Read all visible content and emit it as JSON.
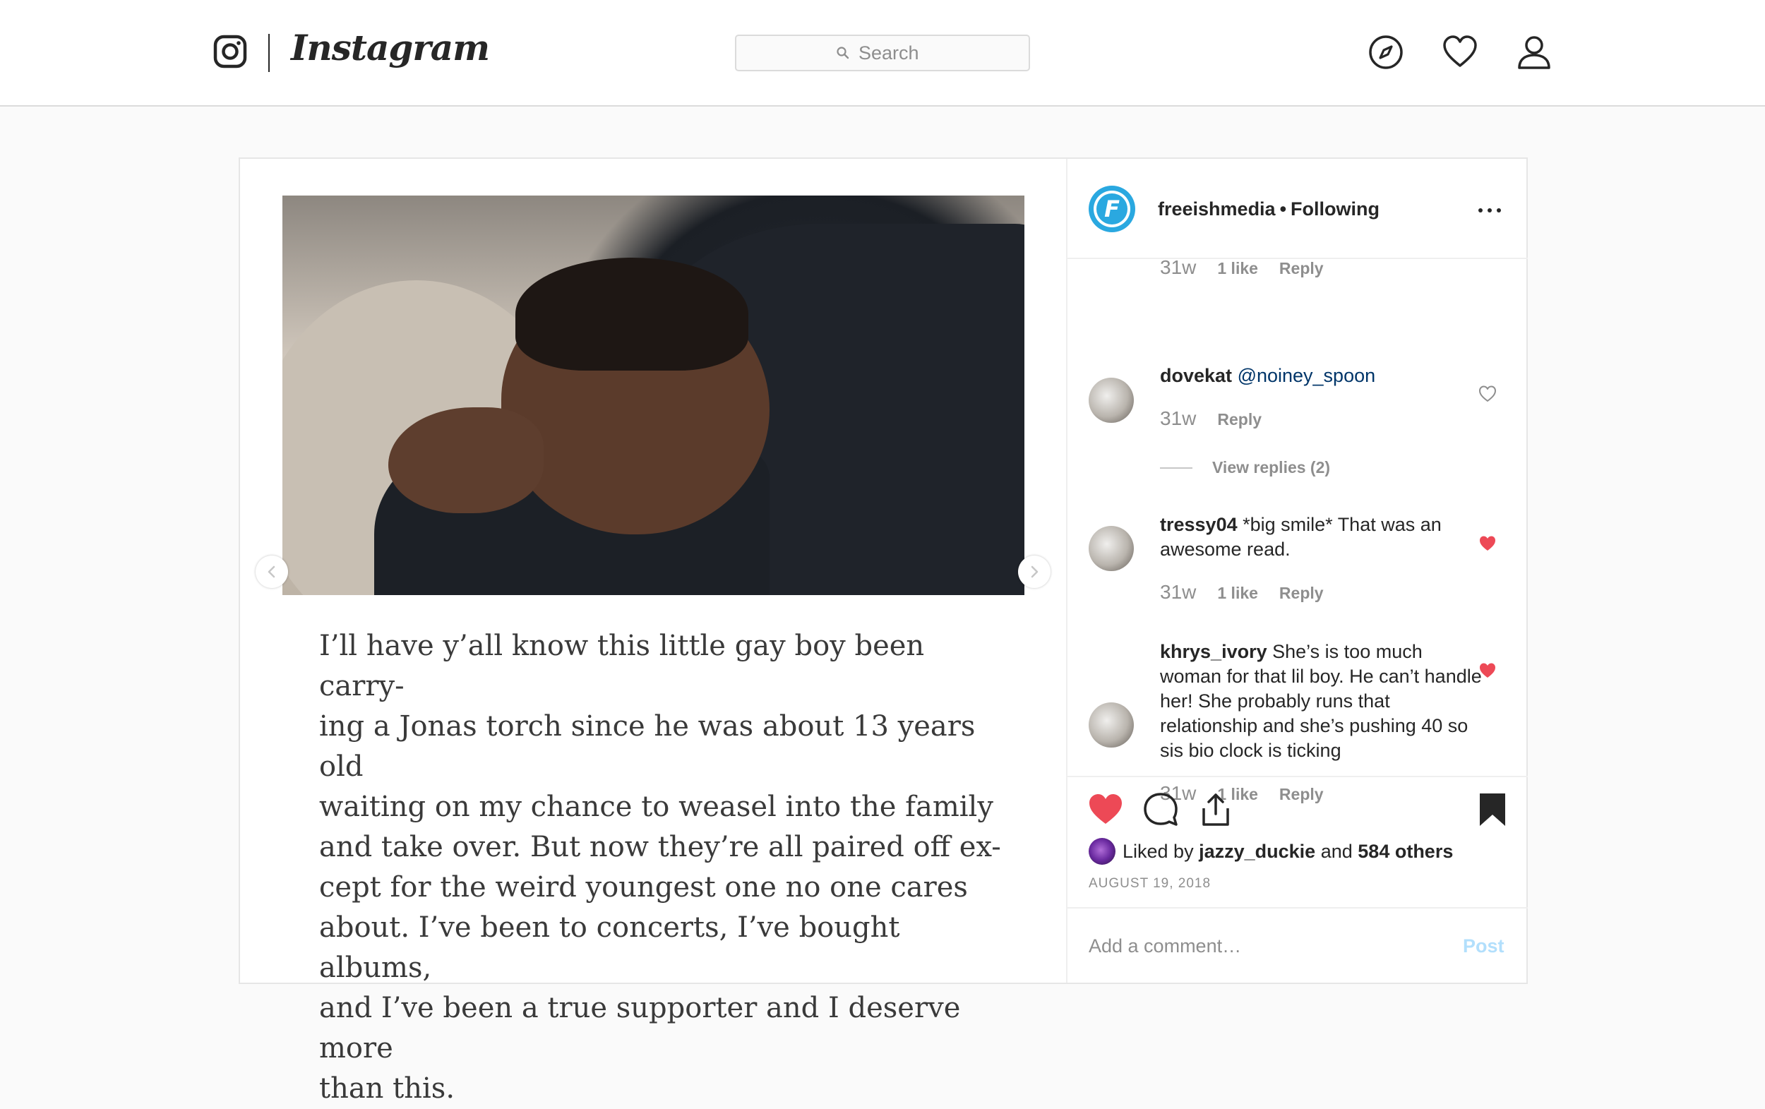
{
  "nav": {
    "brand": "Instagram",
    "search_placeholder": "Search",
    "icons": [
      "instagram-glyph-icon",
      "search-icon",
      "compass-icon",
      "heart-icon",
      "profile-icon"
    ]
  },
  "post": {
    "username": "freeishmedia",
    "follow_status": "Following",
    "separator": "•",
    "quote": "I’ll have y’all know this little gay boy been carry-\ning a Jonas torch since he was about 13 years old\nwaiting on my chance to weasel into the family\nand take over. But now they’re all paired off ex-\ncept for the weird youngest one no one cares\nabout. I’ve been to concerts, I’ve bought albums,\nand I’ve been a true supporter and I deserve more\nthan this.",
    "comments_top": {
      "age": "31w",
      "likes": "1 like",
      "reply": "Reply"
    },
    "comments": [
      {
        "username": "dovekat",
        "mention": "@noiney_spoon",
        "text": "",
        "age": "31w",
        "likes": "",
        "reply": "Reply",
        "liked": false,
        "view_replies": "View replies (2)"
      },
      {
        "username": "tressy04",
        "mention": "",
        "text": "*big smile* That was an awesome read.",
        "age": "31w",
        "likes": "1 like",
        "reply": "Reply",
        "liked": true
      },
      {
        "username": "khrys_ivory",
        "mention": "",
        "text": "She’s is too much woman for that lil boy. He can’t handle her! She probably runs that relationship and she’s pushing 40 so sis bio clock is ticking",
        "age": "31w",
        "likes": "1 like",
        "reply": "Reply",
        "liked": true
      }
    ],
    "liked_by_prefix": "Liked by",
    "liked_by_user": "jazzy_duckie",
    "liked_by_and": "and",
    "liked_by_others": "584 others",
    "date": "August 19, 2018",
    "add_comment_placeholder": "Add a comment…",
    "post_button": "Post"
  },
  "colors": {
    "like_red": "#ed4956",
    "link_blue": "#003569",
    "post_disabled": "#b2dffc",
    "brand_avatar": "#2aa8e0",
    "muted": "#8e8e8e"
  }
}
